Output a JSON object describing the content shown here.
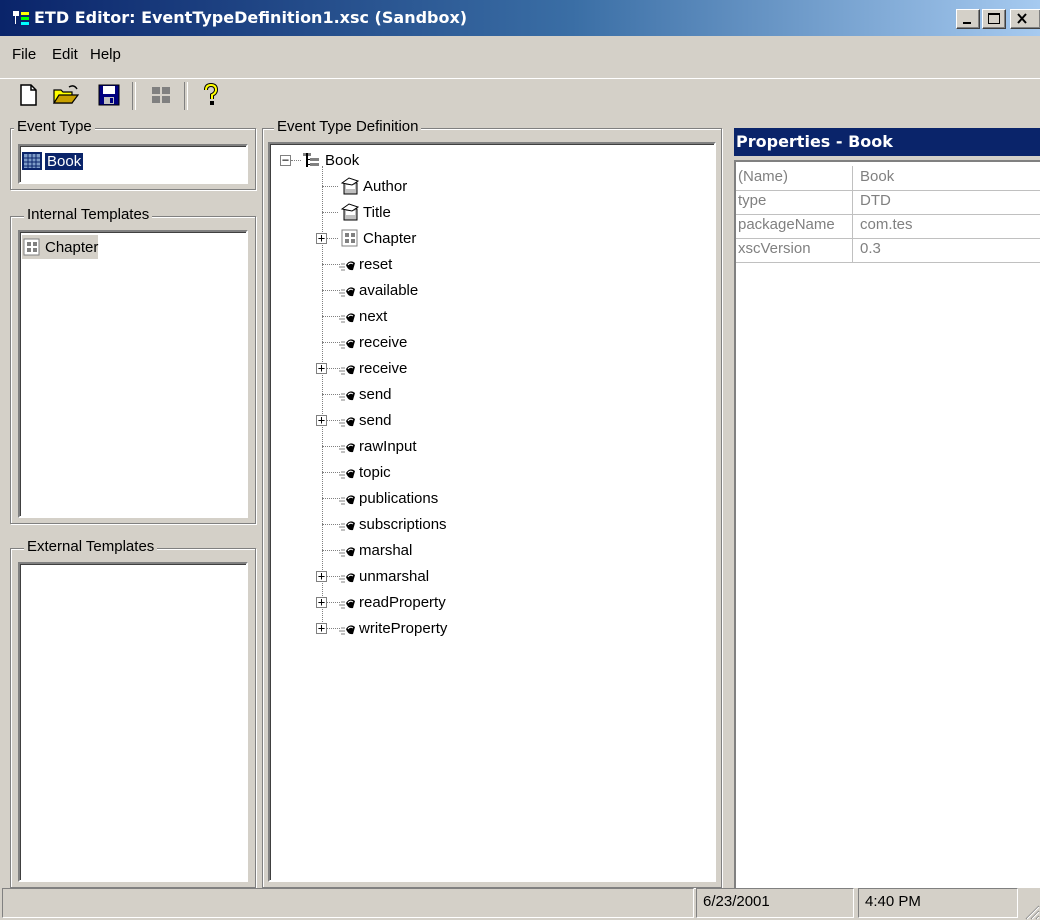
{
  "window": {
    "title": "ETD Editor: EventTypeDefinition1.xsc (Sandbox)",
    "minimize_glyph": "_",
    "maximize_glyph": "□",
    "close_glyph": "✕"
  },
  "menu": {
    "items": [
      "File",
      "Edit",
      "Help"
    ]
  },
  "toolbar": {
    "buttons": [
      "new-file-icon",
      "open-folder-icon",
      "save-disk-icon",
      "grid-view-icon",
      "help-question-icon"
    ]
  },
  "event_type": {
    "label": "Event Type",
    "items": [
      {
        "text": "Book",
        "selected": true
      }
    ]
  },
  "internal_templates": {
    "label": "Internal Templates",
    "items": [
      {
        "text": "Chapter"
      }
    ]
  },
  "external_templates": {
    "label": "External Templates",
    "items": []
  },
  "tree": {
    "label": "Event Type Definition",
    "root": "Book",
    "children": [
      {
        "text": "Author",
        "kind": "node",
        "expandable": false
      },
      {
        "text": "Title",
        "kind": "node",
        "expandable": false
      },
      {
        "text": "Chapter",
        "kind": "template",
        "expandable": true
      },
      {
        "text": "reset",
        "kind": "method",
        "expandable": false
      },
      {
        "text": "available",
        "kind": "method",
        "expandable": false
      },
      {
        "text": "next",
        "kind": "method",
        "expandable": false
      },
      {
        "text": "receive",
        "kind": "method",
        "expandable": false
      },
      {
        "text": "receive",
        "kind": "method",
        "expandable": true
      },
      {
        "text": "send",
        "kind": "method",
        "expandable": false
      },
      {
        "text": "send",
        "kind": "method",
        "expandable": true
      },
      {
        "text": "rawInput",
        "kind": "method",
        "expandable": false
      },
      {
        "text": "topic",
        "kind": "method",
        "expandable": false
      },
      {
        "text": "publications",
        "kind": "method",
        "expandable": false
      },
      {
        "text": "subscriptions",
        "kind": "method",
        "expandable": false
      },
      {
        "text": "marshal",
        "kind": "method",
        "expandable": false
      },
      {
        "text": "unmarshal",
        "kind": "method",
        "expandable": true
      },
      {
        "text": "readProperty",
        "kind": "method",
        "expandable": true
      },
      {
        "text": "writeProperty",
        "kind": "method",
        "expandable": true
      }
    ]
  },
  "properties": {
    "header": "Properties - Book",
    "rows": [
      {
        "name": "(Name)",
        "value": "Book"
      },
      {
        "name": "type",
        "value": "DTD"
      },
      {
        "name": "packageName",
        "value": "com.tes"
      },
      {
        "name": "xscVersion",
        "value": "0.3"
      }
    ]
  },
  "status": {
    "message": "",
    "date": "6/23/2001",
    "time": "4:40 PM"
  },
  "colors": {
    "title_active": "#0a246a",
    "face": "#d4d0c8",
    "selection": "#0a246a"
  }
}
